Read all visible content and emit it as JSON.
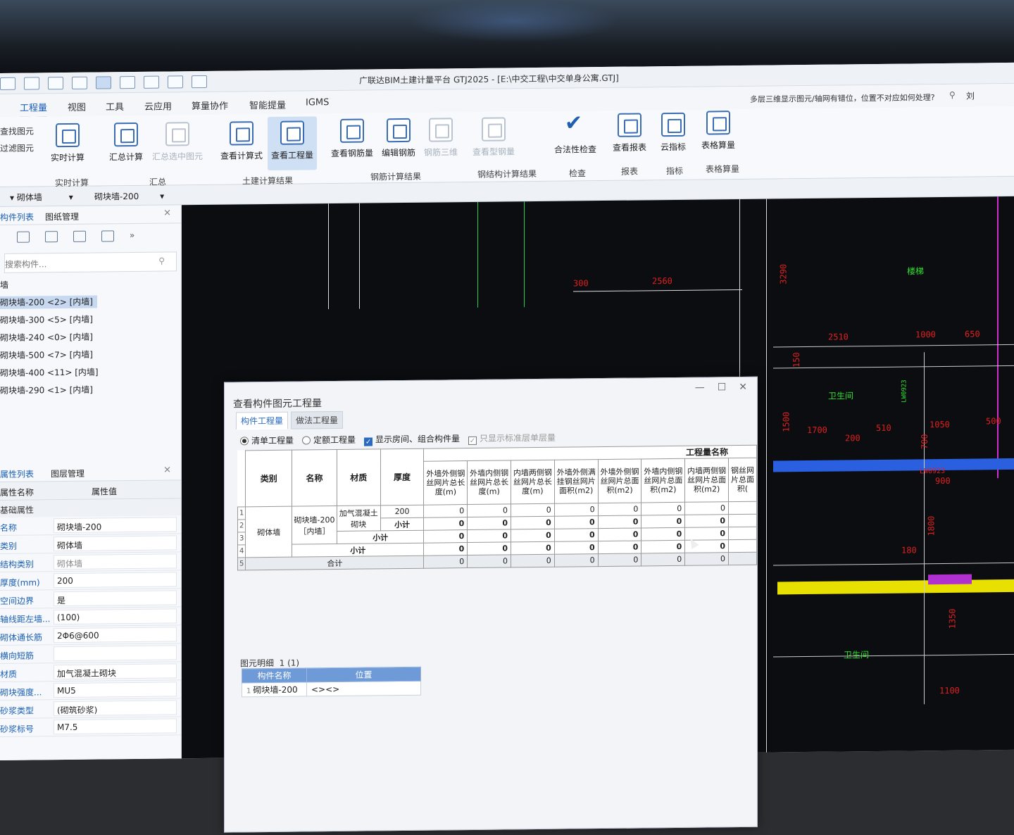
{
  "app": {
    "title": "广联达BIM土建计量平台 GTJ2025 - [E:\\中交工程\\中交单身公寓.GTJ]",
    "help_question": "多层三维显示图元/轴网有错位，位置不对应如何处理?",
    "user": "刘"
  },
  "menu": [
    "工程量",
    "视图",
    "工具",
    "云应用",
    "算量协作",
    "智能提量",
    "IGMS"
  ],
  "ribbon": {
    "side_links": [
      "查找图元",
      "过滤图元"
    ],
    "buttons": {
      "realtime": "实时计算",
      "sum_calc": "汇总计算",
      "sum_selected": "汇总选中图元",
      "view_formula": "查看计算式",
      "view_quantity": "查看工程量",
      "view_rebar_qty": "查看钢筋量",
      "edit_rebar": "编辑钢筋",
      "rebar_3d": "钢筋三维",
      "view_steel": "查看型钢量",
      "legality": "合法性检查",
      "view_report": "查看报表",
      "cloud_index": "云指标",
      "table_calc": "表格算量"
    },
    "groups": {
      "realtime": "实时计算",
      "summary": "汇总",
      "civil": "土建计算结果",
      "rebar": "钢筋计算结果",
      "steel": "钢结构计算结果",
      "check": "检查",
      "report": "报表",
      "index": "指标",
      "table": "表格算量"
    }
  },
  "toolbar2": {
    "category": "砌体墙",
    "component": "砌块墙-200"
  },
  "component_panel": {
    "tab_list": "构件列表",
    "tab_drawings": "图纸管理",
    "search_placeholder": "搜索构件...",
    "group": "墙",
    "items": [
      "砌块墙-200 <2> [内墙]",
      "砌块墙-300 <5> [内墙]",
      "砌块墙-240 <0> [内墙]",
      "砌块墙-500 <7> [内墙]",
      "砌块墙-400 <11> [内墙]",
      "砌块墙-290 <1> [内墙]"
    ]
  },
  "property_panel": {
    "tab_props": "属性列表",
    "tab_layers": "图层管理",
    "col_name": "属性名称",
    "col_value": "属性值",
    "section": "基础属性",
    "rows": [
      {
        "name": "名称",
        "value": "砌块墙-200"
      },
      {
        "name": "类别",
        "value": "砌体墙"
      },
      {
        "name": "结构类别",
        "value": "砌体墙"
      },
      {
        "name": "厚度(mm)",
        "value": "200"
      },
      {
        "name": "空间边界",
        "value": "是"
      },
      {
        "name": "轴线距左墙...",
        "value": "(100)"
      },
      {
        "name": "砌体通长筋",
        "value": "2Φ6@600"
      },
      {
        "name": "横向短筋",
        "value": ""
      },
      {
        "name": "材质",
        "value": "加气混凝土砌块"
      },
      {
        "name": "砌块强度...",
        "value": "MU5"
      },
      {
        "name": "砂浆类型",
        "value": "(砌筑砂浆)"
      },
      {
        "name": "砂浆标号",
        "value": "M7.5"
      }
    ]
  },
  "dialog": {
    "title": "查看构件图元工程量",
    "tab_component": "构件工程量",
    "tab_method": "做法工程量",
    "opt_list": "清单工程量",
    "opt_quota": "定额工程量",
    "opt_show_room": "显示房间、组合构件量",
    "opt_std_floor": "只显示标准层单层量",
    "table": {
      "group_header": "工程量名称",
      "headers": [
        "类别",
        "名称",
        "材质",
        "厚度"
      ],
      "qty_headers": [
        "外墙外侧钢丝网片总长度(m)",
        "外墙内侧钢丝网片总长度(m)",
        "内墙两侧钢丝网片总长度(m)",
        "外墙外侧满挂钢丝网片面积(m2)",
        "外墙外侧钢丝网片总面积(m2)",
        "外墙内侧钢丝网片总面积(m2)",
        "内墙两侧钢丝网片总面积(m2)",
        "钢丝网片总面积("
      ],
      "row_numbers": [
        "1",
        "2",
        "3",
        "4",
        "5"
      ],
      "category": "砌体墙",
      "name": "砌块墙-200［内墙］",
      "material": "加气混凝土砌块",
      "thickness": "200",
      "subtotal": "小计",
      "total": "合计",
      "zero": "0"
    },
    "detail_label": "图元明细",
    "detail_count": "1 (1)",
    "detail_headers": [
      "构件名称",
      "位置"
    ],
    "detail_rows": [
      {
        "no": "1",
        "name": "砌块墙-200",
        "pos": "<><>"
      }
    ]
  },
  "cad_labels": [
    "300",
    "2560",
    "3290",
    "2510",
    "1000",
    "650",
    "150",
    "1500",
    "1700",
    "200",
    "510",
    "1050",
    "700",
    "500",
    "900",
    "180",
    "1800",
    "1350",
    "1100",
    "卫生间",
    "楼梯",
    "LW0923"
  ]
}
